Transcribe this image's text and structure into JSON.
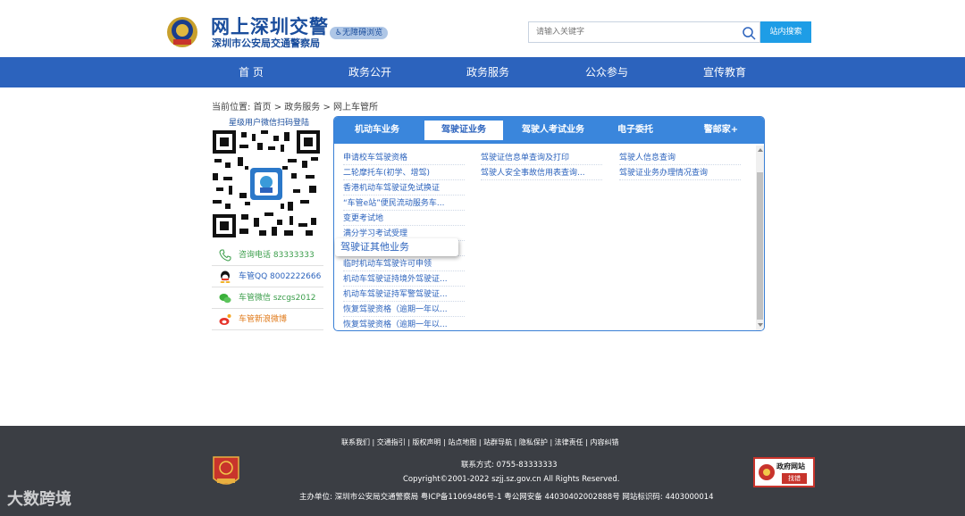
{
  "header": {
    "title": "网上深圳交警",
    "subtitle": "深圳市公安局交通警察局",
    "accessibility_label": "无障碍浏览",
    "search_placeholder": "请输入关键字",
    "search_button": "站内搜索"
  },
  "nav": [
    "首 页",
    "政务公开",
    "政务服务",
    "公众参与",
    "宣传教育"
  ],
  "breadcrumb": "当前位置:  首页 > 政务服务 > 网上车管所",
  "sidebar": {
    "qr_title": "星级用户微信扫码登陆",
    "contacts": [
      {
        "icon": "phone-icon",
        "text": "咨询电话  83333333",
        "color": "#3a9d4a"
      },
      {
        "icon": "qq-icon",
        "text": "车管QQ  8002222666",
        "color": "#2c63bd"
      },
      {
        "icon": "wechat-icon",
        "text": "车管微信  szcgs2012",
        "color": "#3a9d4a"
      },
      {
        "icon": "weibo-icon",
        "text": "车管新浪微博",
        "color": "#e07a1a"
      }
    ]
  },
  "tabs": [
    "机动车业务",
    "驾驶证业务",
    "驾驶人考试业务",
    "电子委托",
    "警邮家+"
  ],
  "active_tab": 1,
  "col1_links": [
    "申请校车驾驶资格",
    "二轮摩托车(初学、增驾)",
    "香港机动车驾驶证免试换证",
    "“车管e站”便民流动服务车...",
    "变更考试地",
    "满分学习考试受理",
    "",
    "临时机动车驾驶许可申领",
    "机动车驾驶证持境外驾驶证...",
    "机动车驾驶证持军警驾驶证...",
    "恢复驾驶资格（逾期一年以...",
    "恢复驾驶资格（逾期一年以..."
  ],
  "col2_links": [
    "驾驶证信息单查询及打印",
    "驾驶人安全事故信用表查询..."
  ],
  "col3_links": [
    "驾驶人信息查询",
    "驾驶证业务办理情况查询"
  ],
  "popup_label": "驾驶证其他业务",
  "footer": {
    "links": "联系我们 | 交通指引 | 版权声明 | 站点地图 | 站群导航 | 隐私保护 | 法律责任 | 内容纠错",
    "contact": "联系方式:  0755-83333333",
    "copyright": "Copyright©2001-2022 szjj.sz.gov.cn    All Rights Reserved.",
    "sponsor": "主办单位:  深圳市公安局交通警察局  粤ICP备11069486号-1  粤公网安备 44030402002888号  网站标识码:  4403000014",
    "party_badge_label": "党政机关",
    "gov_badge_top": "政府网站",
    "gov_badge_bottom": "找错"
  },
  "watermark": "大数跨境"
}
